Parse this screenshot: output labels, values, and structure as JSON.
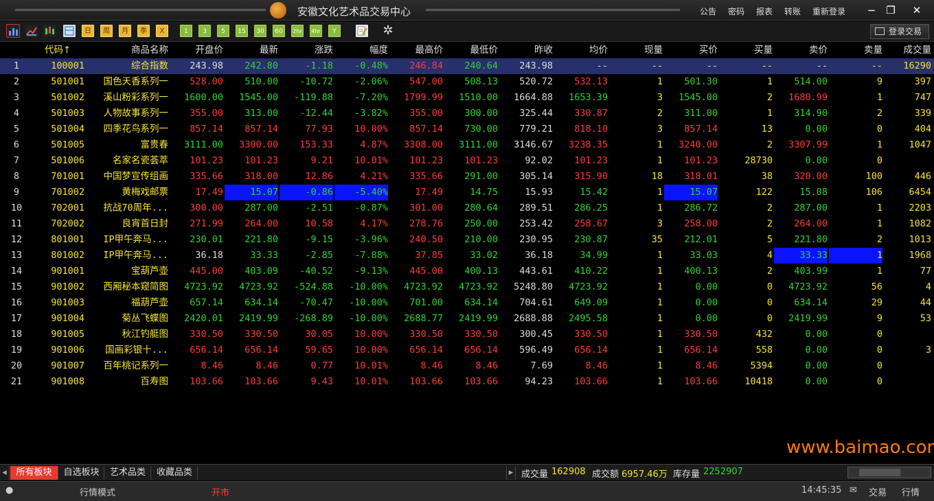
{
  "window": {
    "title": "安徽文化艺术品交易中心",
    "menus": [
      "公告",
      "密码",
      "报表",
      "转账",
      "重新登录"
    ],
    "min": "−",
    "restore": "❐",
    "close": "✕"
  },
  "toolbar": {
    "items": [
      "日",
      "周",
      "月",
      "季",
      "Ⅹ",
      "1",
      "3",
      "5",
      "15",
      "30",
      "60",
      "2hr",
      "4hr",
      "Y"
    ],
    "login_label": "登录交易",
    "settings_icon": "✲"
  },
  "colors": {
    "up": "#ff3b3b",
    "down": "#32d232",
    "highlight": "#0a14ff",
    "selected_row": "#27306a",
    "brand": "#e8392c"
  },
  "table": {
    "headers": [
      "代码↑",
      "商品名称",
      "开盘价",
      "最新",
      "涨跌",
      "幅度",
      "最高价",
      "最低价",
      "昨收",
      "均价",
      "现量",
      "买价",
      "买量",
      "卖价",
      "卖量",
      "成交量"
    ],
    "rows": [
      [
        "1",
        "100001",
        "综合指数",
        "243.98",
        "242.80",
        "-1.18",
        "-0.48%",
        "246.84",
        "240.64",
        "243.98",
        "--",
        "--",
        "--",
        "--",
        "--",
        "--",
        "16290"
      ],
      [
        "2",
        "501001",
        "国色天香系列一",
        "528.00",
        "510.00",
        "-10.72",
        "-2.06%",
        "547.00",
        "508.13",
        "520.72",
        "532.13",
        "1",
        "501.30",
        "1",
        "514.00",
        "9",
        "397"
      ],
      [
        "3",
        "501002",
        "溪山粉彩系列一",
        "1600.00",
        "1545.00",
        "-119.88",
        "-7.20%",
        "1799.99",
        "1510.00",
        "1664.88",
        "1653.39",
        "3",
        "1545.00",
        "2",
        "1680.99",
        "1",
        "747"
      ],
      [
        "4",
        "501003",
        "人物故事系列一",
        "355.00",
        "313.00",
        "-12.44",
        "-3.82%",
        "355.00",
        "300.00",
        "325.44",
        "330.87",
        "2",
        "311.00",
        "1",
        "314.90",
        "2",
        "339"
      ],
      [
        "5",
        "501004",
        "四季花鸟系列一",
        "857.14",
        "857.14",
        "77.93",
        "10.00%",
        "857.14",
        "730.00",
        "779.21",
        "818.10",
        "3",
        "857.14",
        "13",
        "0.00",
        "0",
        "404"
      ],
      [
        "6",
        "501005",
        "富贵春",
        "3111.00",
        "3300.00",
        "153.33",
        "4.87%",
        "3308.00",
        "3111.00",
        "3146.67",
        "3238.35",
        "1",
        "3240.00",
        "2",
        "3307.99",
        "1",
        "1047"
      ],
      [
        "7",
        "501006",
        "名家名瓷荟萃",
        "101.23",
        "101.23",
        "9.21",
        "10.01%",
        "101.23",
        "101.23",
        "92.02",
        "101.23",
        "1",
        "101.23",
        "28730",
        "0.00",
        "0",
        ""
      ],
      [
        "8",
        "701001",
        "中国梦宣传组画",
        "335.66",
        "318.00",
        "12.86",
        "4.21%",
        "335.66",
        "291.00",
        "305.14",
        "315.90",
        "18",
        "318.01",
        "38",
        "320.00",
        "100",
        "446"
      ],
      [
        "9",
        "701002",
        "黄梅戏邮票",
        "17.49",
        "15.07",
        "-0.86",
        "-5.40%",
        "17.49",
        "14.75",
        "15.93",
        "15.42",
        "1",
        "15.07",
        "122",
        "15.08",
        "106",
        "6454"
      ],
      [
        "10",
        "702001",
        "抗战70周年...",
        "300.00",
        "287.00",
        "-2.51",
        "-0.87%",
        "301.00",
        "280.64",
        "289.51",
        "286.25",
        "1",
        "286.72",
        "2",
        "287.00",
        "1",
        "2203"
      ],
      [
        "11",
        "702002",
        "良宵首日封",
        "271.99",
        "264.00",
        "10.58",
        "4.17%",
        "278.76",
        "250.00",
        "253.42",
        "258.67",
        "3",
        "258.00",
        "2",
        "264.00",
        "1",
        "1082"
      ],
      [
        "12",
        "801001",
        "IP甲午奔马...",
        "230.01",
        "221.80",
        "-9.15",
        "-3.96%",
        "240.50",
        "210.00",
        "230.95",
        "230.87",
        "35",
        "212.01",
        "5",
        "221.80",
        "2",
        "1013"
      ],
      [
        "13",
        "801002",
        "IP甲午奔马...",
        "36.18",
        "33.33",
        "-2.85",
        "-7.88%",
        "37.85",
        "33.02",
        "36.18",
        "34.99",
        "1",
        "33.03",
        "4",
        "33.33",
        "1",
        "1968"
      ],
      [
        "14",
        "901001",
        "宝葫芦壶",
        "445.00",
        "403.09",
        "-40.52",
        "-9.13%",
        "445.00",
        "400.13",
        "443.61",
        "410.22",
        "1",
        "400.13",
        "2",
        "403.99",
        "1",
        "77"
      ],
      [
        "15",
        "901002",
        "西厢秘本窥简图",
        "4723.92",
        "4723.92",
        "-524.88",
        "-10.00%",
        "4723.92",
        "4723.92",
        "5248.80",
        "4723.92",
        "1",
        "0.00",
        "0",
        "4723.92",
        "56",
        "4"
      ],
      [
        "16",
        "901003",
        "福葫芦壶",
        "657.14",
        "634.14",
        "-70.47",
        "-10.00%",
        "701.00",
        "634.14",
        "704.61",
        "649.09",
        "1",
        "0.00",
        "0",
        "634.14",
        "29",
        "44"
      ],
      [
        "17",
        "901004",
        "菊丛飞蝶图",
        "2420.01",
        "2419.99",
        "-268.89",
        "-10.00%",
        "2688.77",
        "2419.99",
        "2688.88",
        "2495.58",
        "1",
        "0.00",
        "0",
        "2419.99",
        "9",
        "53"
      ],
      [
        "18",
        "901005",
        "秋江钓艇图",
        "330.50",
        "330.50",
        "30.05",
        "10.00%",
        "330.50",
        "330.50",
        "300.45",
        "330.50",
        "1",
        "330.50",
        "432",
        "0.00",
        "0",
        ""
      ],
      [
        "19",
        "901006",
        "国画彩银十...",
        "656.14",
        "656.14",
        "59.65",
        "10.00%",
        "656.14",
        "656.14",
        "596.49",
        "656.14",
        "1",
        "656.14",
        "558",
        "0.00",
        "0",
        "3"
      ],
      [
        "20",
        "901007",
        "百年桃记系列一",
        "8.46",
        "8.46",
        "0.77",
        "10.01%",
        "8.46",
        "8.46",
        "7.69",
        "8.46",
        "1",
        "8.46",
        "5394",
        "0.00",
        "0",
        ""
      ],
      [
        "21",
        "901008",
        "百寿图",
        "103.66",
        "103.66",
        "9.43",
        "10.01%",
        "103.66",
        "103.66",
        "94.23",
        "103.66",
        "1",
        "103.66",
        "10418",
        "0.00",
        "0",
        ""
      ]
    ]
  },
  "tabs": [
    "所有板块",
    "自选板块",
    "艺术品类",
    "收藏品类"
  ],
  "summary": {
    "vol_label": "成交量",
    "vol": "162908",
    "amt_label": "成交额",
    "amt": "6957.46万",
    "stock_label": "库存量",
    "stock": "2252907"
  },
  "status": {
    "mode": "行情模式",
    "market": "开市",
    "time": "14:45:35",
    "trade": "交易",
    "quote": "行情"
  },
  "watermark": "www.baimao.com"
}
